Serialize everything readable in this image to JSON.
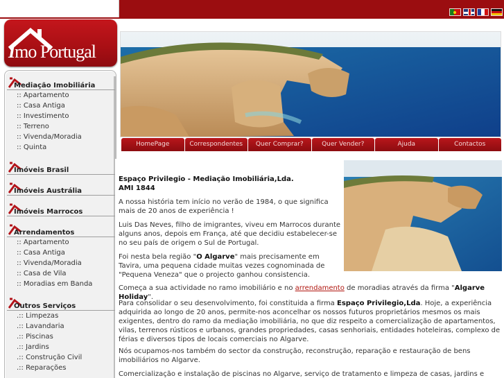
{
  "flags": [
    {
      "name": "portuguese-flag-icon",
      "lang": "pt"
    },
    {
      "name": "english-flag-icon",
      "lang": "en"
    },
    {
      "name": "french-flag-icon",
      "lang": "fr"
    },
    {
      "name": "german-flag-icon",
      "lang": "de"
    }
  ],
  "logo": {
    "text_pre": "I",
    "text_main": "mo Portugal"
  },
  "menu": {
    "sections": [
      {
        "title": "Mediação Imobiliária",
        "items": [
          ":: Apartamento",
          ":: Casa Antiga",
          ":: Investimento",
          ":: Terreno",
          ":: Vivenda/Moradia",
          ":: Quinta"
        ]
      },
      {
        "title": "Imóveis Brasil",
        "items": []
      },
      {
        "title": "Imóveis Austrália",
        "items": []
      },
      {
        "title": "Imóveis Marrocos",
        "items": []
      },
      {
        "title": "Arrendamentos",
        "items": [
          ":: Apartamento",
          ":: Casa Antiga",
          ":: Vivenda/Moradia",
          ":: Casa de Vila",
          ":: Moradias em Banda"
        ]
      },
      {
        "title": "Outros Serviços",
        "items": [
          ".:: Limpezas",
          ".:: Lavandaria",
          ".:: Piscinas",
          ".:: Jardins",
          ".:: Construção Civil",
          ".:: Reparações"
        ]
      }
    ]
  },
  "tabs": [
    "HomePage",
    "Correspondentes",
    "Quer Comprar?",
    "Quer Vender?",
    "Ajuda",
    "Contactos"
  ],
  "content": {
    "company_title": "Espaço Privilegio - Mediação Imobiliária,Lda.",
    "ami": "AMI 1844",
    "p1": "A nossa história tem início no verão de 1984, o que significa mais de 20 anos de experiência !",
    "p2": "Luis Das Neves, filho de imigrantes, viveu em Marrocos durante alguns anos, depois em França, até que decidiu estabelecer-se no seu país de origem o Sul de Portugal.",
    "p3_a": "Foi nesta bela região \"",
    "p3_b": "O Algarve",
    "p3_c": "\" mais precisamente em Tavira, uma pequena cidade muitas vezes cognominada de \"Pequena Veneza\" que o projecto ganhou consistencia.",
    "p4_a": "Começa a sua actividade no ramo imobiliário e no ",
    "p4_link": "arrendamento",
    "p4_b": " de moradias através da firma \"",
    "p4_bold": "Algarve Holiday",
    "p4_c": "\".",
    "p5_a": "Para consolidar o seu desenvolvimento, foi constituida a firma ",
    "p5_bold": "Espaço Privilegio,Lda",
    "p5_b": ". Hoje, a experiência adquirida ao longo de 20 anos, permite-nos aconcelhar os nossos futuros proprietários mesmos os mais exigentes, dentro do ramo da mediação imobiliária, no que diz respeito a comercialização de apartamentos, vilas, terrenos rústicos e urbanos, grandes propriedades, casas senhoriais, entidades hoteleiras, complexo de férias e diversos tipos de locais comerciais no Algarve.",
    "p6": "Nós ocupamos-nos também do sector da construção, reconstrução, reparação e restauração de bens imobiliários no Algarve.",
    "p7": "Comercialização e instalação de piscinas no Algarve, serviço de tratamento e limpeza de casas, jardins e piscinas"
  },
  "colors": {
    "brand_red": "#9b0d10",
    "tab_red": "#a51015",
    "link_red": "#b0160f",
    "sea_blue": "#1f5fa8"
  }
}
